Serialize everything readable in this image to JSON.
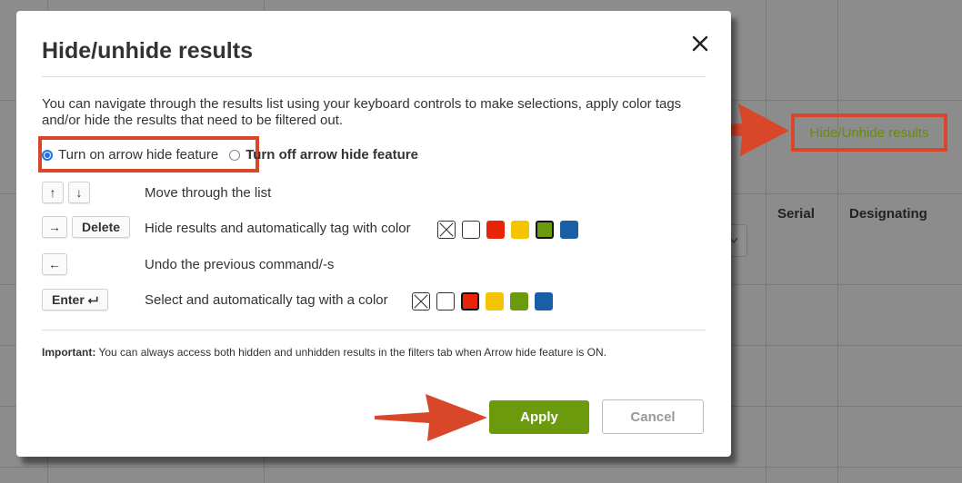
{
  "background": {
    "table_headers": [
      "Serial",
      "Designating"
    ],
    "hide_link_label": "Hide/Unhide results"
  },
  "modal": {
    "title": "Hide/unhide results",
    "description": "You can navigate through the results list using your keyboard controls to make selections, apply color tags and/or hide the results that need to be filtered out.",
    "radio_on_label": "Turn on arrow hide feature",
    "radio_off_label": "Turn off arrow hide feature",
    "rows": [
      {
        "keys": [
          "↑",
          "↓"
        ],
        "text": "Move through the list"
      },
      {
        "keys": [
          "→",
          "Delete"
        ],
        "text": "Hide results and automatically tag with color"
      },
      {
        "keys": [
          "←"
        ],
        "text": "Undo the previous command/-s"
      },
      {
        "keys": [
          "Enter ⮠"
        ],
        "text": "Select and automatically tag with a color"
      }
    ],
    "important_label": "Important:",
    "important_text": " You can always access both hidden and unhidden results in the filters tab when Arrow hide feature is ON.",
    "apply_label": "Apply",
    "cancel_label": "Cancel"
  },
  "colors": {
    "red": "#e8240b",
    "yellow": "#f5c400",
    "green": "#6b9a0c",
    "blue": "#1a5ea8",
    "annotation": "#d9472b"
  },
  "icons": [
    "close-icon",
    "arrow-up-icon",
    "arrow-down-icon",
    "arrow-right-icon",
    "arrow-left-icon",
    "enter-icon",
    "no-color-icon"
  ]
}
